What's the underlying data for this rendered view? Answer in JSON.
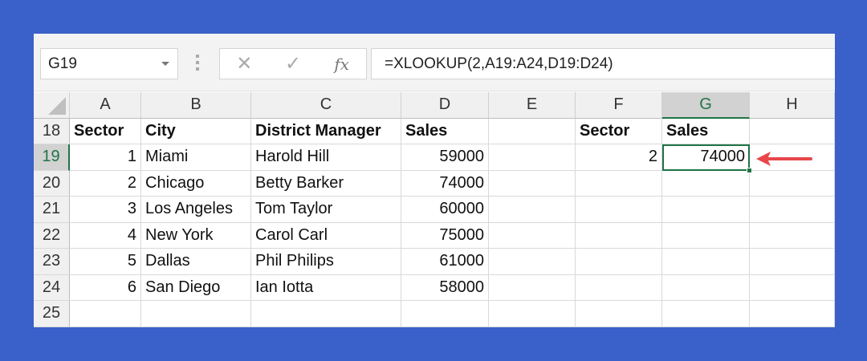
{
  "name_box": "G19",
  "formula_buttons": {
    "cancel": "✕",
    "enter": "✓",
    "fx": "fx"
  },
  "formula": "=XLOOKUP(2,A19:A24,D19:D24)",
  "columns": [
    "A",
    "B",
    "C",
    "D",
    "E",
    "F",
    "G",
    "H"
  ],
  "rows": [
    {
      "n": "18",
      "cells": [
        "Sector",
        "City",
        "District Manager",
        "Sales",
        "",
        "Sector",
        "Sales",
        ""
      ]
    },
    {
      "n": "19",
      "cells": [
        "1",
        "Miami",
        "Harold Hill",
        "59000",
        "",
        "2",
        "74000",
        ""
      ]
    },
    {
      "n": "20",
      "cells": [
        "2",
        "Chicago",
        "Betty Barker",
        "74000",
        "",
        "",
        "",
        ""
      ]
    },
    {
      "n": "21",
      "cells": [
        "3",
        "Los Angeles",
        "Tom Taylor",
        "60000",
        "",
        "",
        "",
        ""
      ]
    },
    {
      "n": "22",
      "cells": [
        "4",
        "New York",
        "Carol Carl",
        "75000",
        "",
        "",
        "",
        ""
      ]
    },
    {
      "n": "23",
      "cells": [
        "5",
        "Dallas",
        "Phil Philips",
        "61000",
        "",
        "",
        "",
        ""
      ]
    },
    {
      "n": "24",
      "cells": [
        "6",
        "San Diego",
        "Ian Iotta",
        "58000",
        "",
        "",
        "",
        ""
      ]
    },
    {
      "n": "25",
      "cells": [
        "",
        "",
        "",
        "",
        "",
        "",
        "",
        ""
      ]
    }
  ],
  "colors": {
    "accent": "#217346",
    "arrow": "#e8474a",
    "background": "#3a60c9"
  }
}
